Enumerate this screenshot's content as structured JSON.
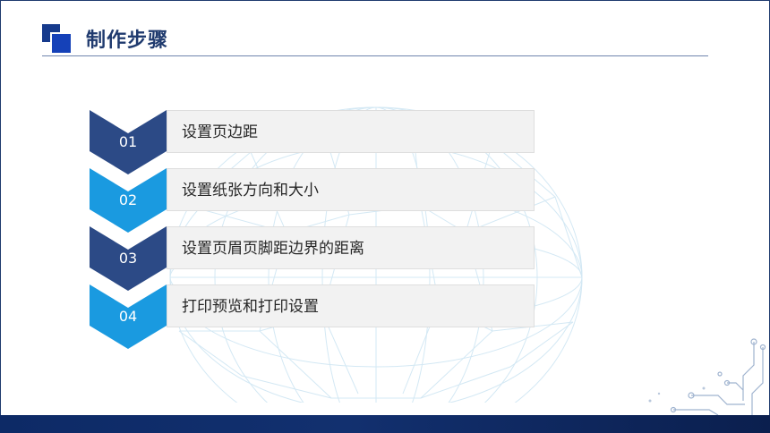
{
  "header": {
    "title": "制作步骤"
  },
  "steps": [
    {
      "number": "01",
      "text": "设置页边距",
      "color": "#2c4a86"
    },
    {
      "number": "02",
      "text": "设置纸张方向和大小",
      "color": "#1a9ae0"
    },
    {
      "number": "03",
      "text": "设置页眉页脚距边界的距离",
      "color": "#2c4a86"
    },
    {
      "number": "04",
      "text": "打印预览和打印设置",
      "color": "#1a9ae0"
    }
  ],
  "colors": {
    "dark_blue": "#2c4a86",
    "light_blue": "#1a9ae0",
    "title": "#1f3a6e"
  }
}
